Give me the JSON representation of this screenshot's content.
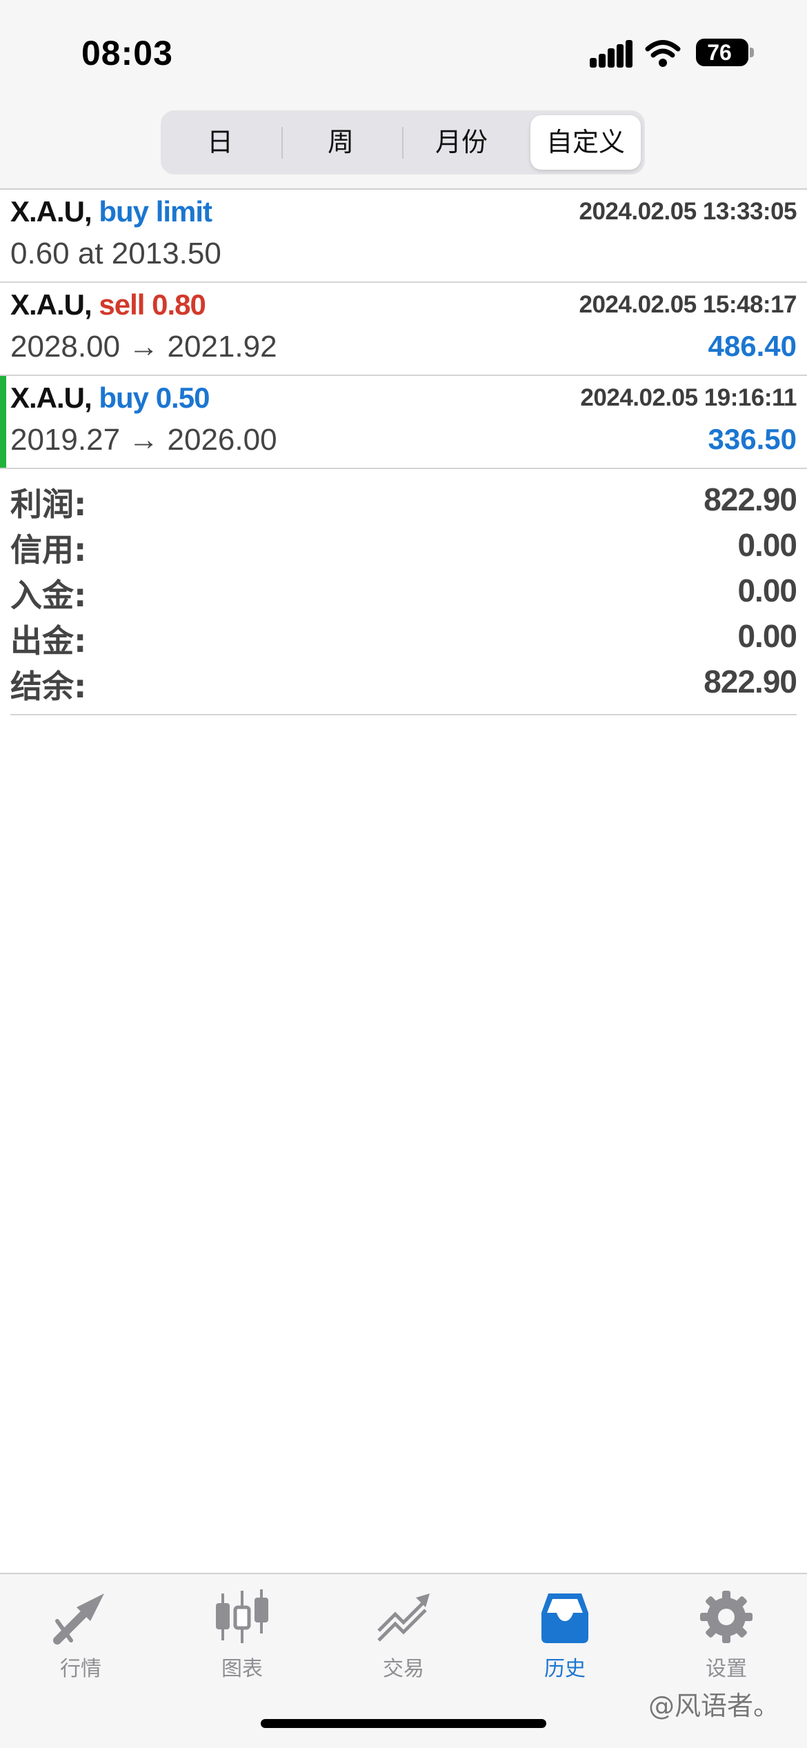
{
  "status_bar": {
    "time": "08:03",
    "battery": "76"
  },
  "segments": [
    {
      "label": "日",
      "active": false
    },
    {
      "label": "周",
      "active": false
    },
    {
      "label": "月份",
      "active": false
    },
    {
      "label": "自定义",
      "active": true
    }
  ],
  "orders": [
    {
      "symbol": "X.A.U,",
      "side": "buy limit",
      "side_color": "#1b76d1",
      "time": "2024.02.05 13:33:05",
      "detail": "0.60 at 2013.50",
      "profit": ""
    },
    {
      "symbol": "X.A.U,",
      "side": "sell 0.80",
      "side_color": "#d23a2c",
      "time": "2024.02.05 15:48:17",
      "detail": "2028.00 → 2021.92",
      "profit": "486.40"
    },
    {
      "symbol": "X.A.U,",
      "side": "buy 0.50",
      "side_color": "#1b76d1",
      "time": "2024.02.05 19:16:11",
      "detail": "2019.27 → 2026.00",
      "profit": "336.50",
      "marked": true
    }
  ],
  "summary": [
    {
      "label": "利润:",
      "value": "822.90"
    },
    {
      "label": "信用:",
      "value": "0.00"
    },
    {
      "label": "入金:",
      "value": "0.00"
    },
    {
      "label": "出金:",
      "value": "0.00"
    },
    {
      "label": "结余:",
      "value": "822.90"
    }
  ],
  "tabs": [
    {
      "label": "行情",
      "icon": "quotes-arrows-icon",
      "active": false
    },
    {
      "label": "图表",
      "icon": "candlestick-chart-icon",
      "active": false
    },
    {
      "label": "交易",
      "icon": "trade-trend-icon",
      "active": false
    },
    {
      "label": "历史",
      "icon": "history-inbox-icon",
      "active": true
    },
    {
      "label": "设置",
      "icon": "gear-icon",
      "active": false
    }
  ],
  "watermark": "@风语者。",
  "colors": {
    "accent": "#1b76d1",
    "sell": "#d23a2c",
    "marker": "#1fb23c",
    "tab_inactive": "#8e8e93"
  }
}
